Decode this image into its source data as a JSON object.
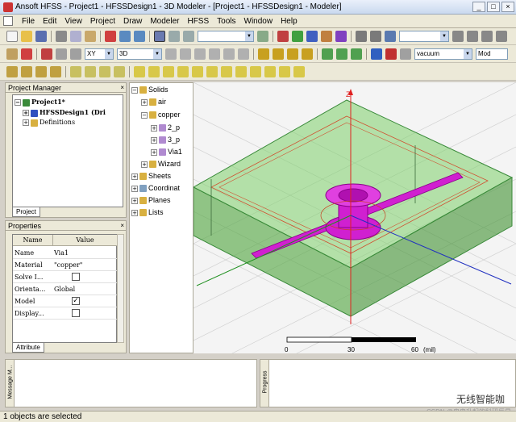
{
  "window": {
    "title": "Ansoft HFSS - Project1 - HFSSDesign1 - 3D Modeler - [Project1 - HFSSDesign1 - Modeler]"
  },
  "menu": [
    "File",
    "Edit",
    "View",
    "Project",
    "Draw",
    "Modeler",
    "HFSS",
    "Tools",
    "Window",
    "Help"
  ],
  "toolbar": {
    "plane": "XY",
    "dimension": "3D",
    "material": "vacuum",
    "model_mode": "Mod"
  },
  "project_manager": {
    "title": "Project Manager",
    "project": "Project1*",
    "design": "HFSSDesign1 (Dri",
    "definitions": "Definitions",
    "tab": "Project"
  },
  "history_tree": {
    "solids": "Solids",
    "air": "air",
    "copper": "copper",
    "port2": "2_p",
    "port3": "3_p",
    "via": "Via1",
    "wizard": "Wizard",
    "sheets": "Sheets",
    "coordinates": "Coordinat",
    "planes": "Planes",
    "lists": "Lists"
  },
  "properties": {
    "title": "Properties",
    "col_name": "Name",
    "col_value": "Value",
    "rows": [
      {
        "name": "Name",
        "value": "Via1"
      },
      {
        "name": "Material",
        "value": "\"copper\""
      },
      {
        "name": "Solve I...",
        "value": ""
      },
      {
        "name": "Orienta...",
        "value": "Global"
      },
      {
        "name": "Model",
        "value": ""
      },
      {
        "name": "Display...",
        "value": ""
      }
    ],
    "model_checked": "✓",
    "tab": "Attribute"
  },
  "viewport": {
    "axis_z": "Z",
    "scale": {
      "t0": "0",
      "t1": "30",
      "t2": "60",
      "unit": "(mil)"
    }
  },
  "message_label": "Message M...",
  "progress_label": "Progress",
  "status": "1 objects are selected",
  "watermark": "无线智能咖",
  "watermark_sub": "CSDN @冉冉升起的科研巨星",
  "colors": {
    "substrate": "#6fbf5a",
    "via": "#d020d0",
    "titlebar": "#c9d9ef"
  }
}
